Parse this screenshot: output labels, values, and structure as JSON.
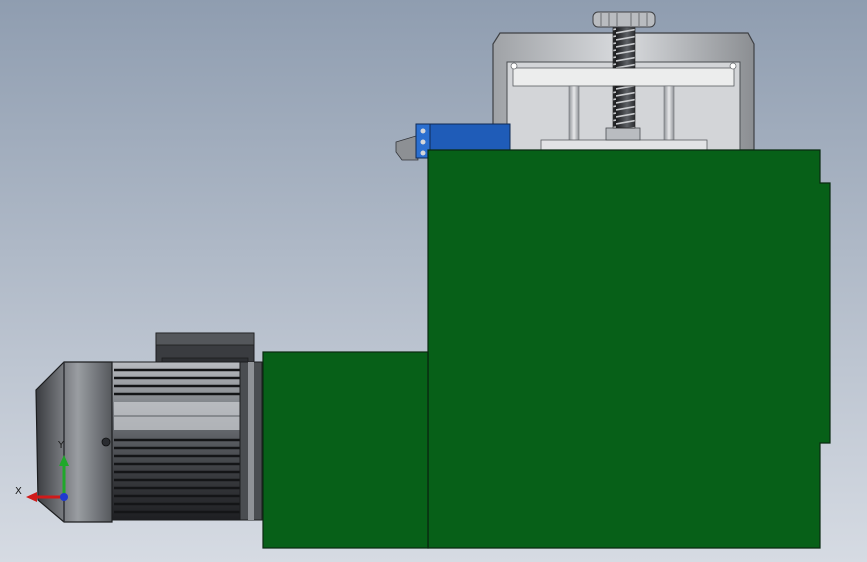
{
  "viewport": {
    "background_top": "#8f9db0",
    "background_bottom": "#d6dbe3"
  },
  "colors": {
    "housing_green": "#076018",
    "housing_edge": "#0a2a10",
    "motor_gray": "#7c7f84",
    "motor_dark": "#26272a",
    "frame_gray": "#c7c9cc",
    "frame_dark": "#55585c",
    "clamp_blue": "#1f5cb8",
    "axis_x": "#d01a1a",
    "axis_y": "#1fa82a",
    "axis_z": "#1f3ad0"
  },
  "triad": {
    "x_label": "X",
    "y_label": "Y"
  }
}
